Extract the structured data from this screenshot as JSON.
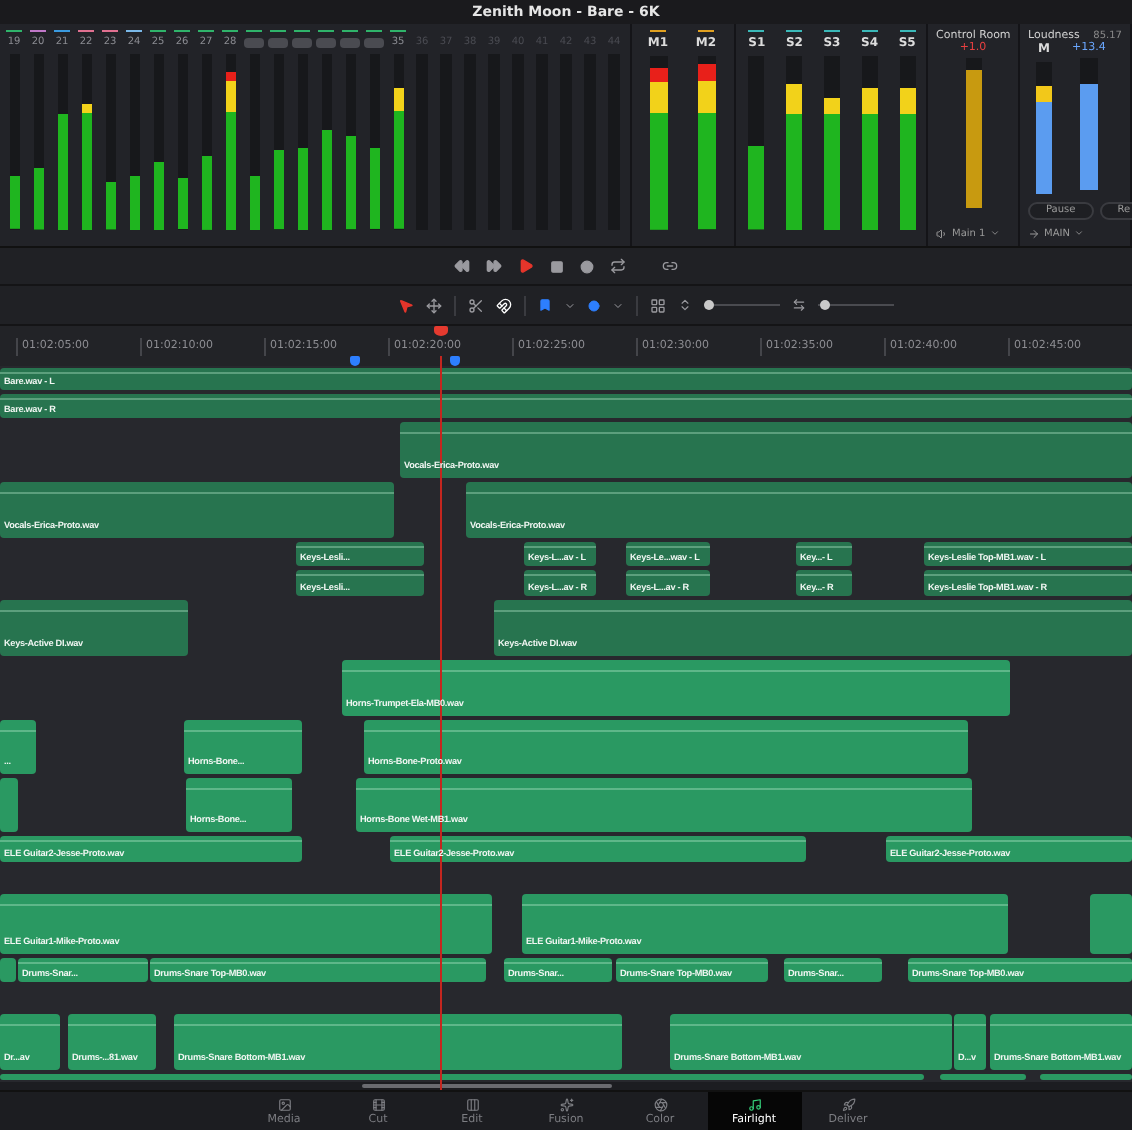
{
  "window": {
    "title": "Zenith Moon - Bare - 6K"
  },
  "channels": [
    {
      "kind": "number",
      "label": "19",
      "level": 0.3
    },
    {
      "kind": "number",
      "label": "20",
      "level": 0.35
    },
    {
      "kind": "number",
      "label": "21",
      "level": 0.66
    },
    {
      "kind": "number",
      "label": "22",
      "level": 0.72
    },
    {
      "kind": "number",
      "label": "23",
      "level": 0.27
    },
    {
      "kind": "number",
      "label": "24",
      "level": 0.31
    },
    {
      "kind": "number",
      "label": "25",
      "level": 0.39
    },
    {
      "kind": "number",
      "label": "26",
      "level": 0.29
    },
    {
      "kind": "number",
      "label": "27",
      "level": 0.42
    },
    {
      "kind": "number",
      "label": "28",
      "level": 0.9
    },
    {
      "kind": "grouped",
      "level": 0.31
    },
    {
      "kind": "grouped",
      "level": 0.45
    },
    {
      "kind": "grouped",
      "level": 0.47
    },
    {
      "kind": "grouped",
      "level": 0.57
    },
    {
      "kind": "grouped",
      "level": 0.53
    },
    {
      "kind": "grouped",
      "level": 0.46
    },
    {
      "kind": "number",
      "label": "35",
      "level": 0.8
    },
    {
      "kind": "inactive",
      "label": "36"
    },
    {
      "kind": "inactive",
      "label": "37"
    },
    {
      "kind": "inactive",
      "label": "38"
    },
    {
      "kind": "inactive",
      "label": "39"
    },
    {
      "kind": "inactive",
      "label": "40"
    },
    {
      "kind": "inactive",
      "label": "41"
    },
    {
      "kind": "inactive",
      "label": "42"
    },
    {
      "kind": "inactive",
      "label": "43"
    },
    {
      "kind": "inactive",
      "label": "44"
    }
  ],
  "mains": [
    {
      "label": "M1",
      "level": 0.93
    },
    {
      "label": "M2",
      "level": 0.95
    }
  ],
  "subs": [
    {
      "label": "S1",
      "level": 0.48
    },
    {
      "label": "S2",
      "level": 0.84
    },
    {
      "label": "S3",
      "level": 0.76
    },
    {
      "label": "S4",
      "level": 0.82
    },
    {
      "label": "S5",
      "level": 0.82
    }
  ],
  "control_room": {
    "title": "Control Room",
    "reading": "+1.0",
    "level": 0.92,
    "output": "Main 1"
  },
  "loudness": {
    "title": "Loudness",
    "value": "85.17",
    "meters": [
      {
        "label": "M",
        "level": 0.82
      },
      {
        "label": "+13.4",
        "level": 0.8
      }
    ],
    "buttons": [
      "Pause",
      "Re"
    ],
    "output": "MAIN"
  },
  "zoom_sliders": [
    {
      "level": 0.05
    },
    {
      "level": 0.08
    }
  ],
  "ruler": {
    "timecodes": [
      "01:02:05:00",
      "01:02:10:00",
      "01:02:15:00",
      "01:02:20:00",
      "01:02:25:00",
      "01:02:30:00",
      "01:02:35:00",
      "01:02:40:00",
      "01:02:45:00"
    ]
  },
  "tracks": [
    {
      "color": "#27744f",
      "clips": [
        {
          "name": "Bare.wav - L"
        }
      ]
    },
    {
      "color": "#27744f",
      "clips": [
        {
          "name": "Bare.wav - R"
        }
      ]
    },
    {
      "color": "#27744f",
      "clips": [
        {
          "name": "Vocals-Erica-Proto.wav"
        }
      ]
    },
    {
      "color": "#27744f",
      "clips": [
        {
          "name": "Vocals-Erica-Proto.wav"
        },
        {
          "name": "Vocals-Erica-Proto.wav"
        }
      ]
    },
    {
      "color": "#27744f",
      "clips": [
        {
          "name": "Keys-Lesli..."
        },
        {
          "name": "Keys-L...av - L"
        },
        {
          "name": "Keys-Le...wav - L"
        },
        {
          "name": "Key...- L"
        },
        {
          "name": "Keys-Leslie Top-MB1.wav - L"
        }
      ]
    },
    {
      "color": "#27744f",
      "clips": [
        {
          "name": "Keys-Lesli..."
        },
        {
          "name": "Keys-L...av - R"
        },
        {
          "name": "Keys-L...av - R"
        },
        {
          "name": "Key...- R"
        },
        {
          "name": "Keys-Leslie Top-MB1.wav - R"
        }
      ]
    },
    {
      "color": "#27744f",
      "clips": [
        {
          "name": "Keys-Active DI.wav"
        },
        {
          "name": "Keys-Active DI.wav"
        }
      ]
    },
    {
      "color": "#2a9962",
      "clips": [
        {
          "name": "Horns-Trumpet-Ela-MB0.wav"
        }
      ]
    },
    {
      "color": "#2a9962",
      "clips": [
        {
          "name": "..."
        },
        {
          "name": "Horns-Bone..."
        },
        {
          "name": "Horns-Bone-Proto.wav"
        }
      ]
    },
    {
      "color": "#2a9962",
      "clips": [
        {
          "kind": "untitled"
        },
        {
          "name": "Horns-Bone..."
        },
        {
          "name": "Horns-Bone Wet-MB1.wav"
        }
      ]
    },
    {
      "color": "#2a9962",
      "clips": [
        {
          "name": "ELE Guitar2-Jesse-Proto.wav"
        },
        {
          "name": "ELE Guitar2-Jesse-Proto.wav"
        },
        {
          "name": "ELE Guitar2-Jesse-Proto.wav"
        }
      ]
    },
    {
      "color": "#2a9962",
      "clips": [
        {
          "name": "ELE Guitar1-Mike-Proto.wav"
        },
        {
          "name": "ELE Guitar1-Mike-Proto.wav"
        },
        {
          "kind": "untitled"
        }
      ]
    },
    {
      "color": "#2a9962",
      "clips": [
        {
          "kind": "untitled"
        },
        {
          "name": "Drums-Snar..."
        },
        {
          "name": "Drums-Snare Top-MB0.wav"
        },
        {
          "name": "Drums-Snar..."
        },
        {
          "name": "Drums-Snare Top-MB0.wav"
        },
        {
          "name": "Drums-Snar..."
        },
        {
          "name": "Drums-Snare Top-MB0.wav"
        }
      ]
    },
    {
      "color": "#2a9962",
      "clips": [
        {
          "name": "Dr...av"
        },
        {
          "name": "Drums-...81.wav"
        },
        {
          "name": "Drums-Snare Bottom-MB1.wav"
        },
        {
          "name": "Drums-Snare Bottom-MB1.wav"
        },
        {
          "name": "D...v"
        },
        {
          "name": "Drums-Snare Bottom-MB1.wav"
        }
      ]
    },
    {
      "color": "#2a9962",
      "clips": [
        {
          "kind": "untitled"
        },
        {
          "kind": "untitled"
        },
        {
          "kind": "untitled"
        }
      ]
    }
  ],
  "pages": [
    {
      "label": "Media",
      "selected": false
    },
    {
      "label": "Cut",
      "selected": false
    },
    {
      "label": "Edit",
      "selected": false
    },
    {
      "label": "Fusion",
      "selected": false
    },
    {
      "label": "Color",
      "selected": false
    },
    {
      "label": "Fairlight",
      "selected": true
    },
    {
      "label": "Deliver",
      "selected": false
    }
  ]
}
